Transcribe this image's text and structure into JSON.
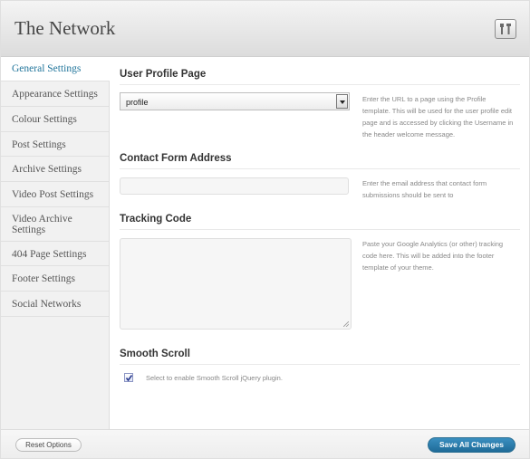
{
  "header": {
    "title": "The Network",
    "icon": "tools-icon"
  },
  "sidebar": {
    "items": [
      {
        "label": "General Settings",
        "active": true
      },
      {
        "label": "Appearance Settings"
      },
      {
        "label": "Colour Settings"
      },
      {
        "label": "Post Settings"
      },
      {
        "label": "Archive Settings"
      },
      {
        "label": "Video Post Settings"
      },
      {
        "label": "Video Archive Settings"
      },
      {
        "label": "404 Page Settings"
      },
      {
        "label": "Footer Settings"
      },
      {
        "label": "Social Networks"
      }
    ]
  },
  "main": {
    "user_profile": {
      "title": "User Profile Page",
      "selected_value": "profile",
      "help": "Enter the URL to a page using the Profile template. This will be used for the user profile edit page and is accessed by clicking the Username in the header welcome message."
    },
    "contact_form": {
      "title": "Contact Form Address",
      "value": "",
      "help": "Enter the email address that contact form submissions should be sent to"
    },
    "tracking_code": {
      "title": "Tracking Code",
      "value": "",
      "help": "Paste your Google Analytics (or other) tracking code here. This will be added into the footer template of your theme."
    },
    "smooth_scroll": {
      "title": "Smooth Scroll",
      "checked": true,
      "label": "Select to enable Smooth Scroll jQuery plugin."
    }
  },
  "footer": {
    "reset_label": "Reset Options",
    "save_label": "Save All Changes"
  },
  "colors": {
    "accent": "#21759b",
    "save_button": "#2a80b3"
  }
}
